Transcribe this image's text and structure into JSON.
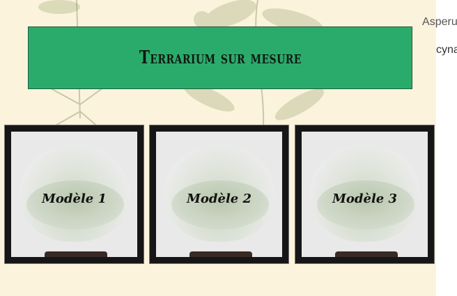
{
  "header": {
    "title": "Terrarium sur mesure"
  },
  "corner_text": {
    "line1": "Asperula",
    "line2": "cyna"
  },
  "models": [
    {
      "label": "Modèle 1"
    },
    {
      "label": "Modèle 2"
    },
    {
      "label": "Modèle 3"
    }
  ],
  "colors": {
    "header_bg": "#2bab6b",
    "page_bg": "#fbf3dc",
    "card_frame": "#161616"
  }
}
